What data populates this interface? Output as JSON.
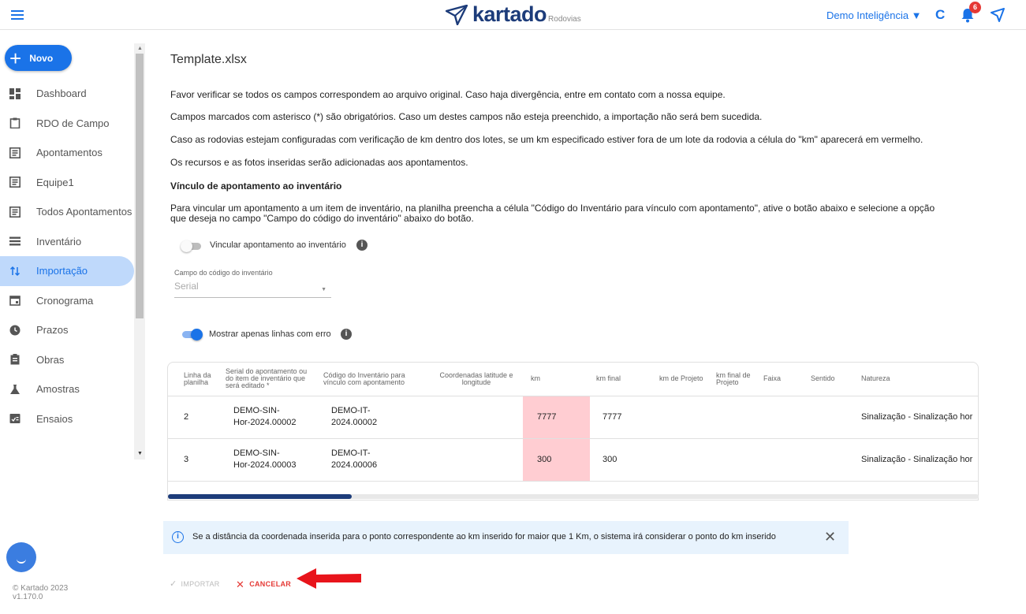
{
  "brand": {
    "name": "kartado",
    "sub": "Rodovias",
    "color": "#1d3c7a"
  },
  "topbar": {
    "org_label": "Demo Inteligência ▼",
    "refresh_icon": "refresh-icon",
    "notifications_count": "6"
  },
  "sidebar": {
    "new_label": "Novo",
    "items": [
      {
        "label": "Dashboard",
        "icon": "dashboard-icon"
      },
      {
        "label": "RDO de Campo",
        "icon": "clipboard-icon"
      },
      {
        "label": "Apontamentos",
        "icon": "list-icon"
      },
      {
        "label": "Equipe1",
        "icon": "list-icon"
      },
      {
        "label": "Todos Apontamentos",
        "icon": "list-icon"
      },
      {
        "label": "Inventário",
        "icon": "inventory-icon"
      },
      {
        "label": "Importação",
        "icon": "import-icon"
      },
      {
        "label": "Cronograma",
        "icon": "calendar-icon"
      },
      {
        "label": "Prazos",
        "icon": "clock-icon"
      },
      {
        "label": "Obras",
        "icon": "clipboard-icon"
      },
      {
        "label": "Amostras",
        "icon": "flask-icon"
      },
      {
        "label": "Ensaios",
        "icon": "report-icon"
      }
    ],
    "active_index": 6,
    "copyright": "© Kartado 2023",
    "version": "v1.170.0"
  },
  "main": {
    "file_title": "Template.xlsx",
    "p1": "Favor verificar se todos os campos correspondem ao arquivo original. Caso haja divergência, entre em contato com a nossa equipe.",
    "p2": "Campos marcados com asterisco (*) são obrigatórios. Caso um destes campos não esteja preenchido, a importação não será bem sucedida.",
    "p3": "Caso as rodovias estejam configuradas com verificação de km dentro dos lotes, se um km especificado estiver fora de um lote da rodovia a célula do \"km\" aparecerá em vermelho.",
    "p4": "Os recursos e as fotos inseridas serão adicionadas aos apontamentos.",
    "section_title": "Vínculo de apontamento ao inventário",
    "p5a": "Para vincular um apontamento a um item de inventário, na planilha preencha a célula \"Código do Inventário para vínculo com apontamento\", ative o botão abaixo e selecione a opção",
    "p5b": "que deseja no campo \"Campo do código do inventário\" abaixo do botão.",
    "toggle_link_label": "Vincular apontamento ao inventário",
    "toggle_link_on": false,
    "field_label": "Campo do código do inventário",
    "field_value": "Serial",
    "toggle_errors_label": "Mostrar apenas linhas com erro",
    "toggle_errors_on": true
  },
  "table": {
    "headers": [
      "Linha da planilha",
      "Serial do apontamento ou do item de inventário que será editado *",
      "Código do Inventário para vínculo com apontamento",
      "Coordenadas latitude e longitude",
      "km",
      "km final",
      "km de Projeto",
      "km final de Projeto",
      "Faixa",
      "Sentido",
      "Natureza"
    ],
    "rows": [
      {
        "linha": "2",
        "serial": "DEMO-SIN-Hor-2024.00002",
        "codigo": "DEMO-IT-2024.00002",
        "coord": "",
        "km": "7777",
        "km_final": "7777",
        "km_proj": "",
        "km_final_proj": "",
        "faixa": "",
        "sentido": "",
        "natureza": "Sinalização - Sinalização hor"
      },
      {
        "linha": "3",
        "serial": "DEMO-SIN-Hor-2024.00003",
        "codigo": "DEMO-IT-2024.00006",
        "coord": "",
        "km": "300",
        "km_final": "300",
        "km_proj": "",
        "km_final_proj": "",
        "faixa": "",
        "sentido": "",
        "natureza": "Sinalização - Sinalização hor"
      }
    ],
    "error_color": "#ffcdd2"
  },
  "alert": {
    "text": "Se a distância da coordenada inserida para o ponto correspondente ao km inserido for maior que 1 Km, o sistema irá considerar o ponto do km inserido"
  },
  "actions": {
    "import_label": "IMPORTAR",
    "cancel_label": "CANCELAR"
  },
  "colors": {
    "accent": "#1a73e8",
    "danger": "#e53935",
    "annotation_arrow": "#e8141b"
  }
}
